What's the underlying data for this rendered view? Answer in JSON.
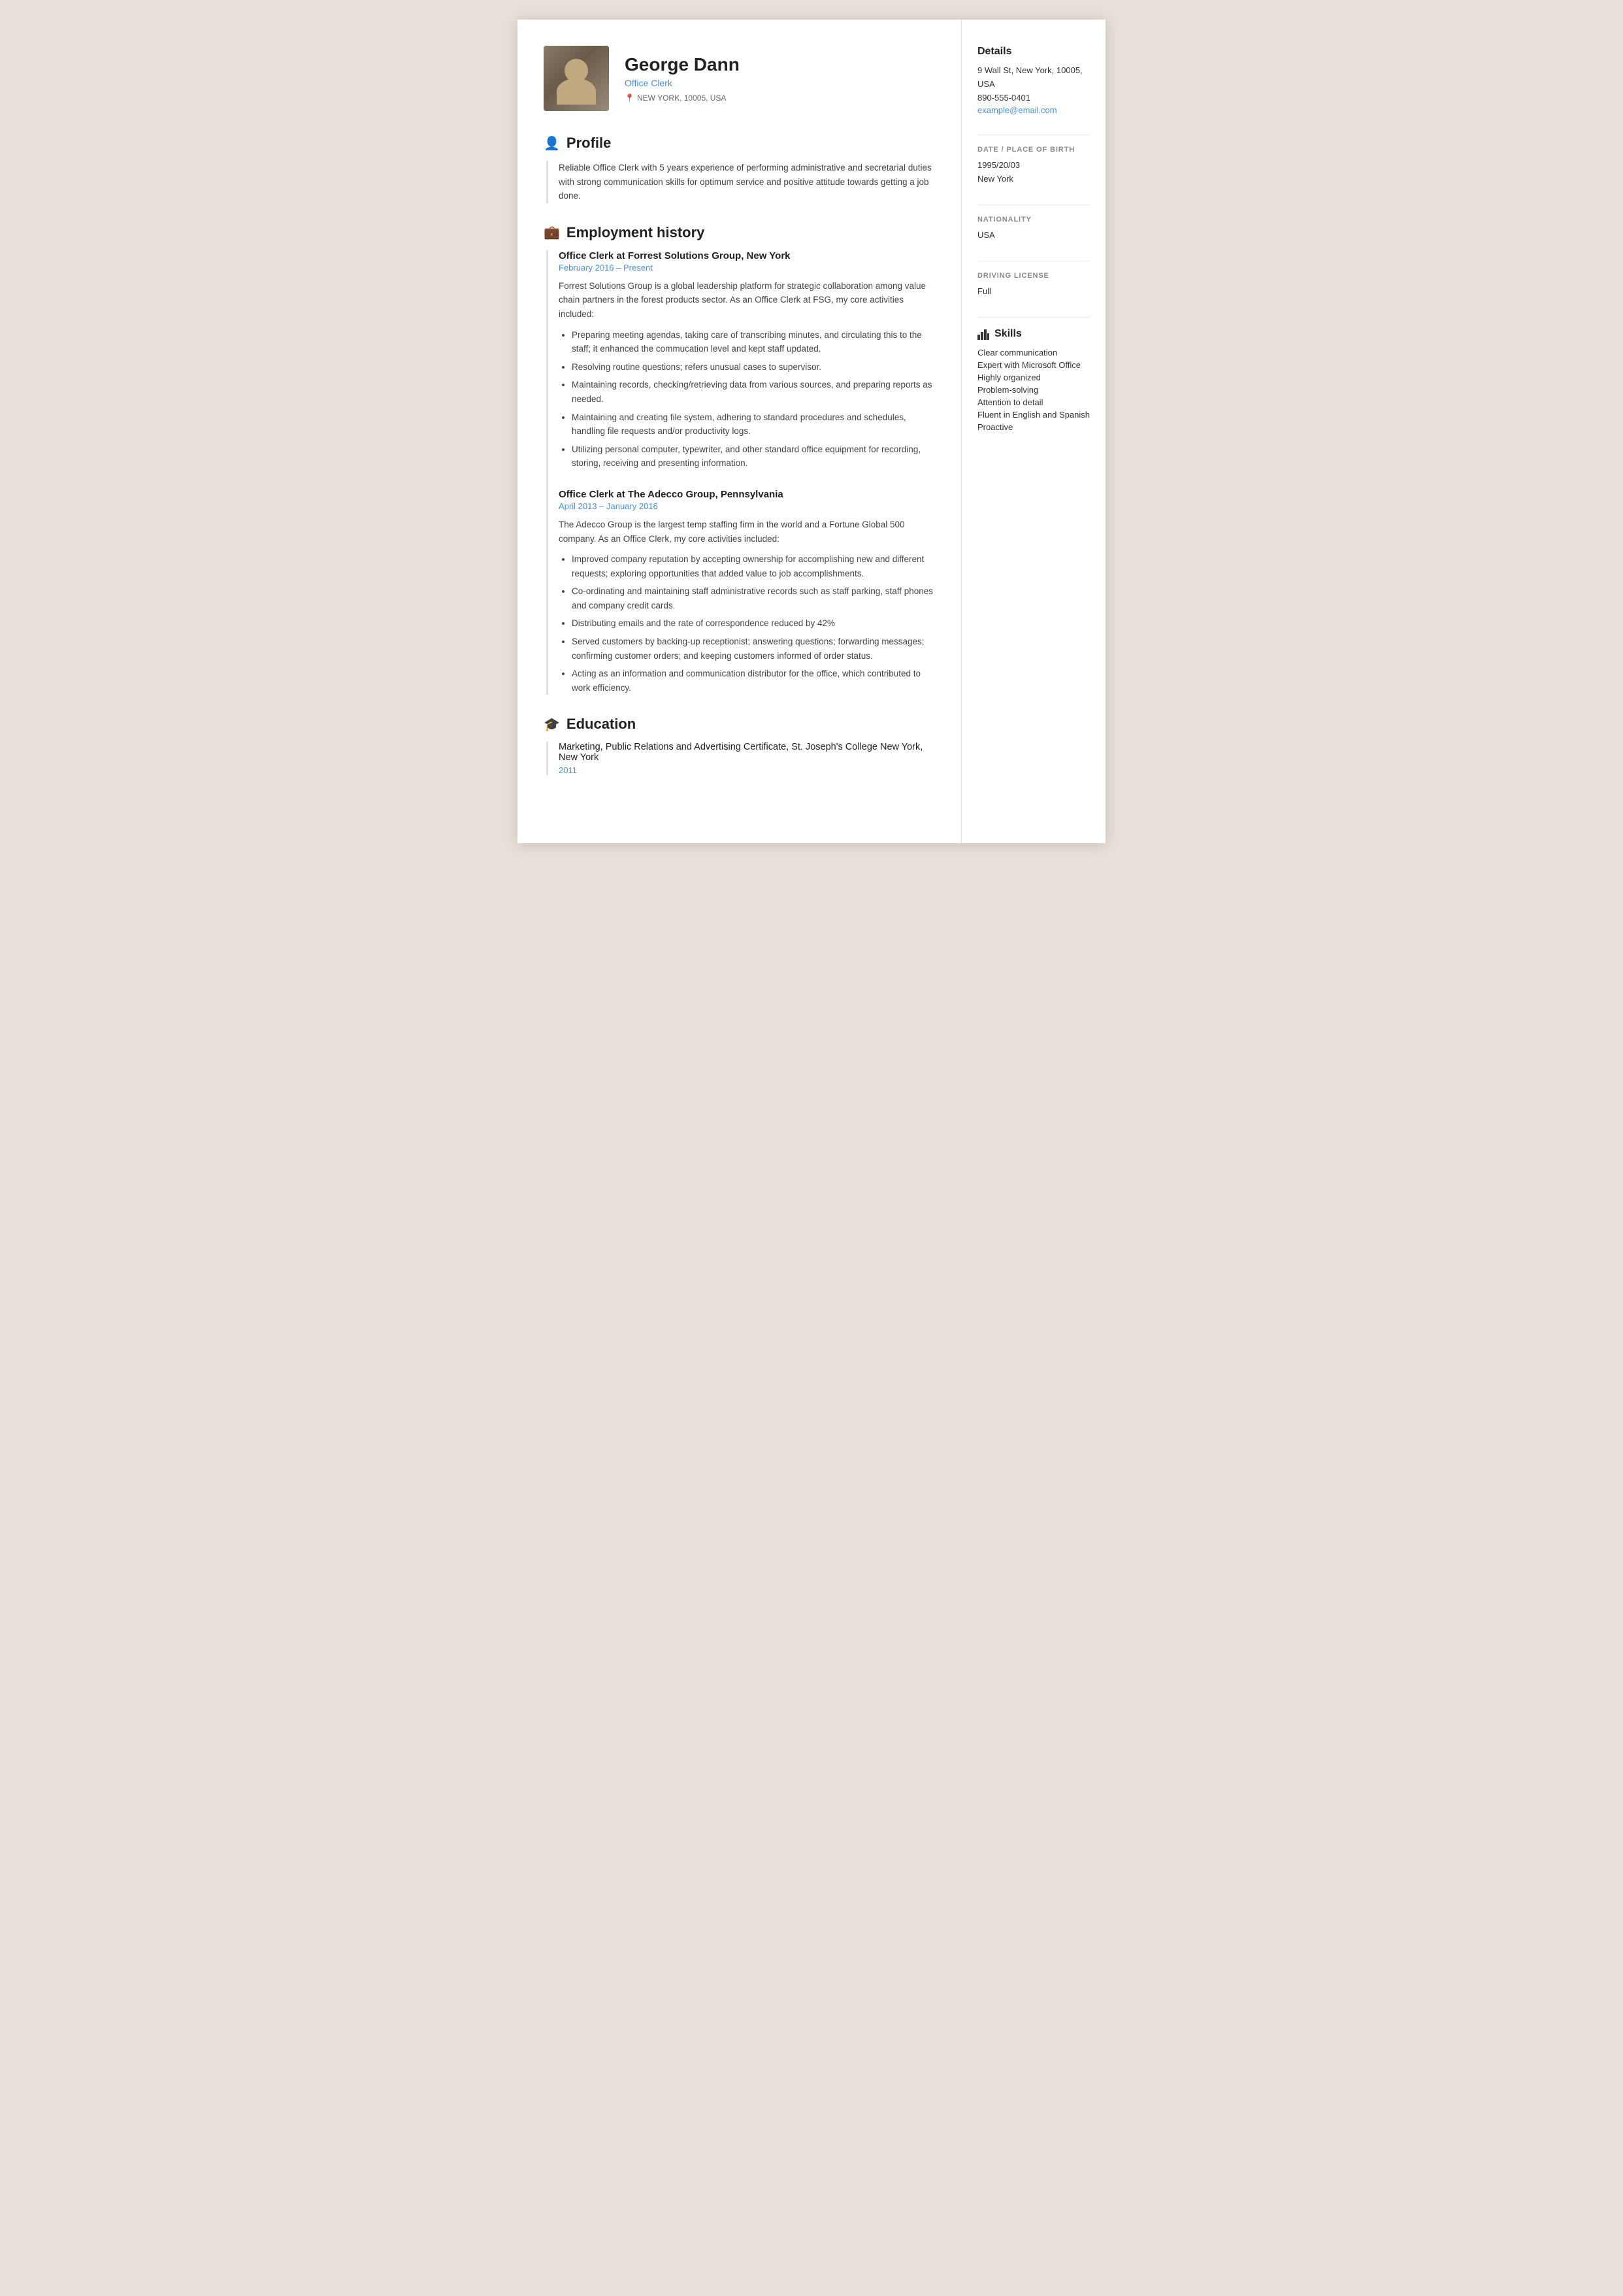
{
  "header": {
    "name": "George Dann",
    "job_title": "Office Clerk",
    "location": "NEW YORK, 10005, USA"
  },
  "profile": {
    "section_title": "Profile",
    "text": "Reliable Office Clerk with 5 years experience of performing administrative and secretarial duties with strong communication skills for optimum service and positive attitude towards getting a job done."
  },
  "employment": {
    "section_title": "Employment history",
    "jobs": [
      {
        "title": "Office Clerk at Forrest Solutions Group, New York",
        "dates": "February 2016  –  Present",
        "description": "Forrest Solutions Group is a global leadership platform for strategic collaboration among value chain partners in the forest products sector. As an Office Clerk at FSG, my core activities included:",
        "bullets": [
          "Preparing meeting agendas, taking  care of transcribing minutes, and circulating this to the staff; it enhanced the commucation level and kept staff updated.",
          "Resolving  routine questions; refers unusual cases to supervisor.",
          "Maintaining records, checking/retrieving data from various sources, and preparing reports as needed.",
          "Maintaining and creating file system, adhering to standard procedures and schedules, handling file requests and/or productivity logs.",
          "Utilizing personal computer, typewriter, and other standard office equipment for recording, storing, receiving and presenting information."
        ]
      },
      {
        "title": "Office Clerk at The Adecco Group, Pennsylvania",
        "dates": "April 2013  –  January 2016",
        "description": "The Adecco Group is the largest temp staffing firm in the world and a Fortune Global 500 company. As an Office Clerk, my core activities included:",
        "bullets": [
          "Improved company reputation by accepting ownership for accomplishing new and different requests; exploring opportunities that added value to job accomplishments.",
          "Co-ordinating and maintaining staff administrative records such as staff parking, staff phones and company credit cards.",
          "Distributing emails and the rate of correspondence reduced by 42%",
          "Served customers by backing-up receptionist; answering questions; forwarding messages; confirming customer orders; and keeping customers informed of order status.",
          "Acting as an information and communication distributor for the office, which contributed to work efficiency."
        ]
      }
    ]
  },
  "education": {
    "section_title": "Education",
    "entries": [
      {
        "title": "Marketing, Public Relations and Advertising Certificate, St. Joseph's College New York, New York",
        "year": "2011"
      }
    ]
  },
  "sidebar": {
    "details_title": "Details",
    "address": "9 Wall St, New York, 10005, USA",
    "phone": "890-555-0401",
    "email": "example@email.com",
    "dob_label": "DATE / PLACE OF BIRTH",
    "dob": "1995/20/03",
    "birth_place": "New York",
    "nationality_label": "NATIONALITY",
    "nationality": "USA",
    "driving_label": "DRIVING LICENSE",
    "driving": "Full",
    "skills_title": "Skills",
    "skills": [
      "Clear communication",
      "Expert with Microsoft Office",
      "Highly organized",
      "Problem-solving",
      "Attention to detail",
      "Fluent in English and Spanish",
      "Proactive"
    ]
  },
  "icons": {
    "profile": "👤",
    "employment": "💼",
    "education": "🎓",
    "location": "📍",
    "skills": "📊"
  }
}
